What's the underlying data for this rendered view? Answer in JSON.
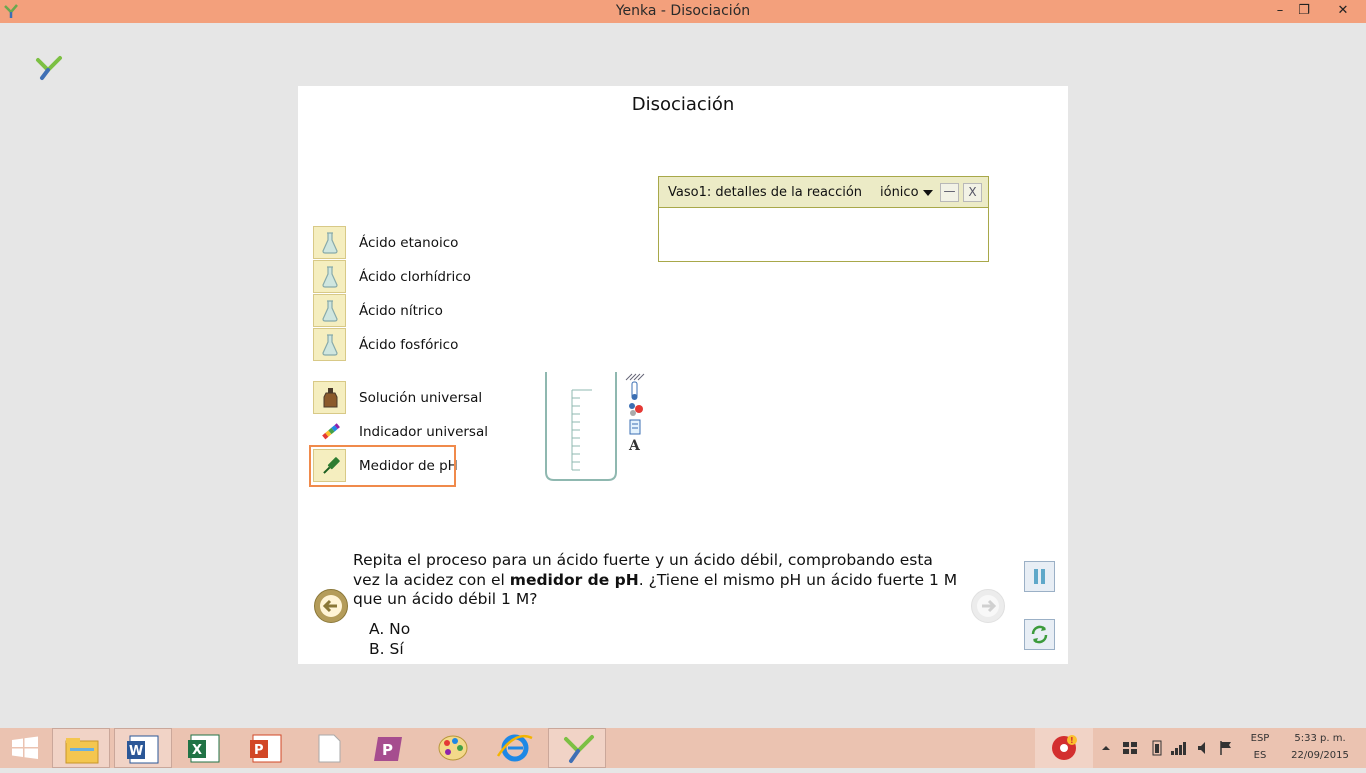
{
  "window": {
    "title": "Yenka - Disociación",
    "minimize": "–",
    "restore": "❐",
    "close": "✕"
  },
  "panel": {
    "title": "Disociación",
    "reaction_window": {
      "label": "Vaso1: detalles de la reacción",
      "mode": "iónico",
      "minimize": "—",
      "close": "X"
    },
    "acids": [
      {
        "label": "Ácido etanoico",
        "icon": "flask-icon"
      },
      {
        "label": "Ácido clorhídrico",
        "icon": "flask-icon"
      },
      {
        "label": "Ácido nítrico",
        "icon": "flask-icon"
      },
      {
        "label": "Ácido fosfórico",
        "icon": "flask-icon"
      }
    ],
    "tools": [
      {
        "label": "Solución universal",
        "icon": "bottle-icon"
      },
      {
        "label": "Indicador universal",
        "icon": "indicator-strip-icon"
      },
      {
        "label": "Medidor de pH",
        "icon": "ph-meter-icon"
      }
    ],
    "question": {
      "text_before": "Repita el proceso para un ácido fuerte y un ácido débil, comprobando esta vez la acidez con el ",
      "bold": "medidor de pH",
      "text_after": ". ¿Tiene el mismo pH un ácido fuerte 1 M que un ácido débil 1 M?",
      "answers": [
        "A. No",
        "B. Sí"
      ]
    }
  },
  "taskbar": {
    "apps": [
      "windows-start-icon",
      "file-explorer-icon",
      "word-icon",
      "excel-icon",
      "powerpoint-icon",
      "notepad-icon",
      "powerpoint-viewer-icon",
      "paint-icon",
      "internet-explorer-icon",
      "yenka-icon"
    ],
    "lang_top": "ESP",
    "lang_bottom": "ES",
    "time": "5:33 p. m.",
    "date": "22/09/2015"
  },
  "colors": {
    "titlebar": "#f3a07c",
    "taskbar": "#ebc3b1",
    "highlight": "#f08a4b",
    "reaction_header": "#ecebc6"
  }
}
